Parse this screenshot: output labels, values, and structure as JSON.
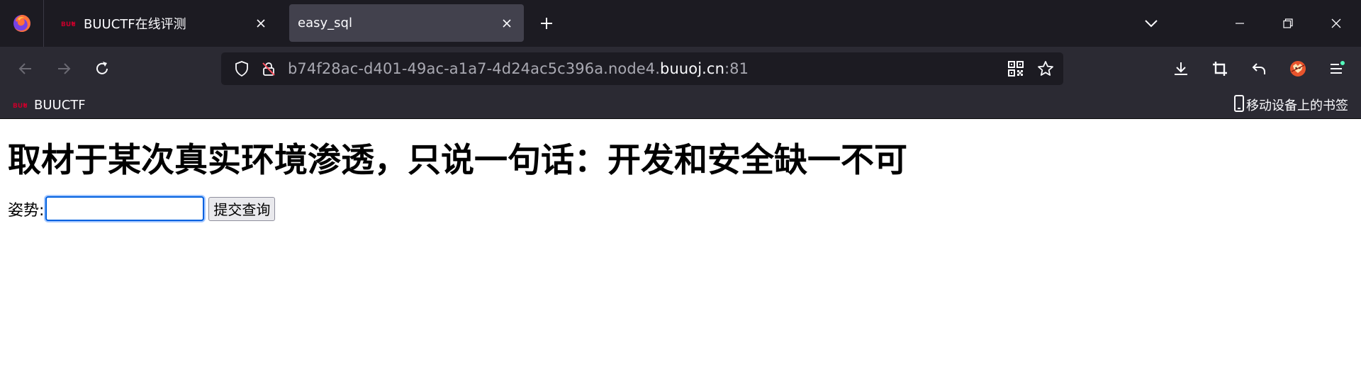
{
  "browser": {
    "tabs": [
      {
        "title": "BUUCTF在线评测",
        "active": false,
        "favicon": "buuctf-favicon"
      },
      {
        "title": "easy_sql",
        "active": true,
        "favicon": ""
      }
    ],
    "url": {
      "prefix": "b74f28ac-d401-49ac-a1a7-4d24ac5c396a.node4.",
      "domain": "buuoj.cn",
      "suffix": ":81"
    },
    "bookmarks": [
      {
        "label": "BUUCTF",
        "favicon": "buuctf-favicon"
      }
    ],
    "mobile_bookmarks_label": "移动设备上的书签"
  },
  "page": {
    "heading": "取材于某次真实环境渗透，只说一句话：开发和安全缺一不可",
    "form": {
      "label": "姿势:",
      "input_value": "",
      "submit_label": "提交查询"
    }
  },
  "colors": {
    "tabstrip_bg": "#1c1b22",
    "toolbar_bg": "#2b2a33",
    "active_tab_bg": "#42414d",
    "urlbar_bg": "#1c1b22",
    "focus_ring": "#0060df",
    "notification_dot": "#54ffbd"
  }
}
